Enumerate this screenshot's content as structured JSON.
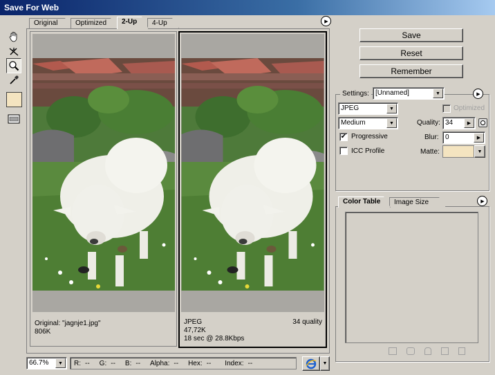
{
  "window": {
    "title": "Save For Web"
  },
  "tabs": [
    {
      "label": "Original"
    },
    {
      "label": "Optimized"
    },
    {
      "label": "2-Up"
    },
    {
      "label": "4-Up"
    }
  ],
  "previews": {
    "left": {
      "line1": "Original: \"jagnje1.jpg\"",
      "line2": "806K"
    },
    "right": {
      "format": "JPEG",
      "size": "47,72K",
      "time": "18 sec @ 28.8Kbps",
      "quality_note": "34 quality"
    }
  },
  "buttons": {
    "save": "Save",
    "reset": "Reset",
    "remember": "Remember"
  },
  "settings": {
    "label": "Settings:",
    "preset": "[Unnamed]",
    "format": "JPEG",
    "quality_level": "Medium",
    "optimized_label": "Optimized",
    "quality_label": "Quality:",
    "quality_value": "34",
    "progressive_label": "Progressive",
    "progressive_checked": "✔",
    "blur_label": "Blur:",
    "blur_value": "0",
    "icc_label": "ICC Profile",
    "matte_label": "Matte:",
    "matte_color": "#f4e4c0"
  },
  "color_table_tabs": [
    {
      "label": "Color Table"
    },
    {
      "label": "Image Size"
    }
  ],
  "status": {
    "zoom": "66.7%",
    "r_label": "R:",
    "r_value": "--",
    "g_label": "G:",
    "g_value": "--",
    "b_label": "B:",
    "b_value": "--",
    "alpha_label": "Alpha:",
    "alpha_value": "--",
    "hex_label": "Hex:",
    "hex_value": "--",
    "index_label": "Index:",
    "index_value": "--"
  },
  "icons": {
    "hand": "hand-tool-icon",
    "slice": "slice-select-icon",
    "zoom": "zoom-tool-icon",
    "eyedropper": "eyedropper-icon",
    "color_swatch": "eyedropper-color-swatch",
    "toggle_slices": "toggle-slices-icon",
    "browser": "internet-explorer-icon"
  }
}
